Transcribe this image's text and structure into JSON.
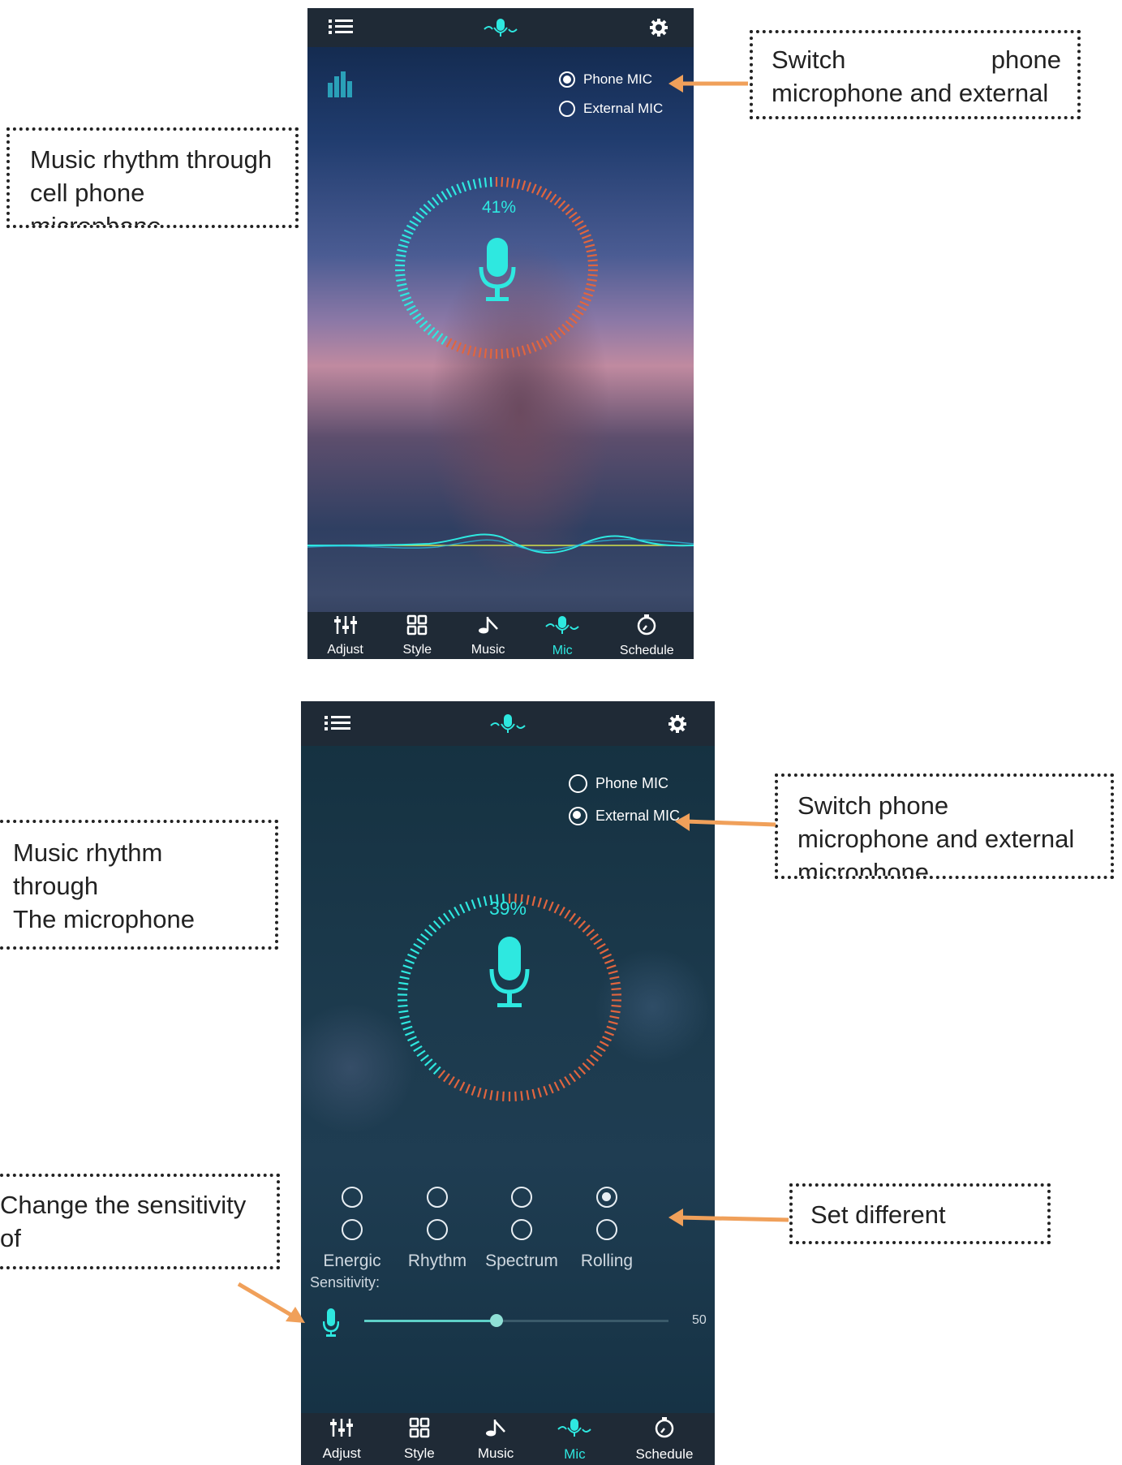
{
  "screen1": {
    "mic_options": [
      {
        "label": "Phone MIC",
        "selected": true
      },
      {
        "label": "External MIC",
        "selected": false
      }
    ],
    "percent": "41%",
    "level_fraction": 0.41
  },
  "screen2": {
    "mic_options": [
      {
        "label": "Phone MIC",
        "selected": false
      },
      {
        "label": "External MIC",
        "selected": true
      }
    ],
    "percent": "39%",
    "level_fraction": 0.39,
    "modes": [
      {
        "label": "Energic",
        "top_selected": false,
        "bottom_selected": false
      },
      {
        "label": "Rhythm",
        "top_selected": false,
        "bottom_selected": false
      },
      {
        "label": "Spectrum",
        "top_selected": false,
        "bottom_selected": false
      },
      {
        "label": "Rolling",
        "top_selected": true,
        "bottom_selected": false
      }
    ],
    "sensitivity_label": "Sensitivity:",
    "sensitivity_value": "50",
    "sensitivity_fraction": 0.5
  },
  "nav": [
    {
      "label": "Adjust",
      "icon": "sliders-icon"
    },
    {
      "label": "Style",
      "icon": "grid-icon"
    },
    {
      "label": "Music",
      "icon": "music-note-icon"
    },
    {
      "label": "Mic",
      "icon": "mic-wave-icon",
      "active": true
    },
    {
      "label": "Schedule",
      "icon": "timer-icon"
    }
  ],
  "callouts": {
    "c1": "Music rhythm through cell phone microphone",
    "c2_line1": "Switch",
    "c2_line1b": "phone",
    "c2_line2": "microphone and external",
    "c3_line1": "Music rhythm",
    "c3_line2": "through",
    "c3_line3": "The microphone",
    "c4_line1": "Switch phone",
    "c4_line2": "microphone and external",
    "c4_line3": "microphone",
    "c5_line1": "Change the sensitivity",
    "c5_line2": "of",
    "c6": "Set different"
  },
  "colors": {
    "accent": "#2ee8e0",
    "level_orange": "#e0653f",
    "arrow": "#f0a05a"
  }
}
